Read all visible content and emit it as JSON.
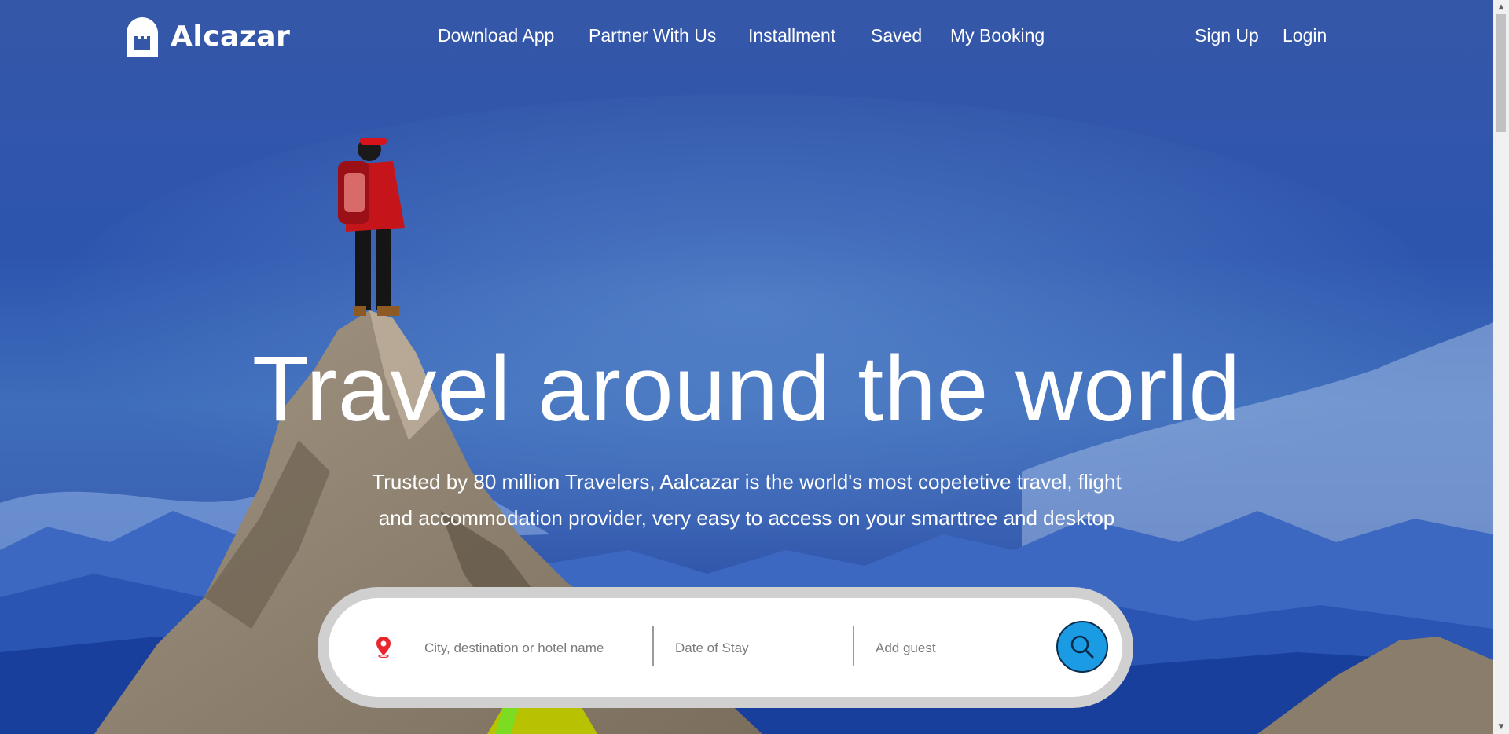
{
  "brand": {
    "name": "Alcazar",
    "logo_icon": "castle-icon"
  },
  "nav": {
    "links": [
      "Download App",
      "Partner With Us",
      "Installment",
      "Saved",
      "My Booking"
    ],
    "signup": "Sign Up",
    "login": "Login"
  },
  "hero": {
    "title": "Travel around the world",
    "subtitle_line1": "Trusted by 80 million Travelers, Aalcazar is the world's most copetetive travel, flight",
    "subtitle_line2": "and accommodation provider, very easy to access on your smarttree and desktop"
  },
  "search": {
    "destination_placeholder": "City, destination or hotel name",
    "date_placeholder": "Date of Stay",
    "guest_placeholder": "Add guest",
    "location_icon": "map-pin-icon",
    "button_icon": "search-icon"
  },
  "colors": {
    "accent": "#1b9be3",
    "pin": "#e8262b",
    "sky": "#2d55ae"
  }
}
